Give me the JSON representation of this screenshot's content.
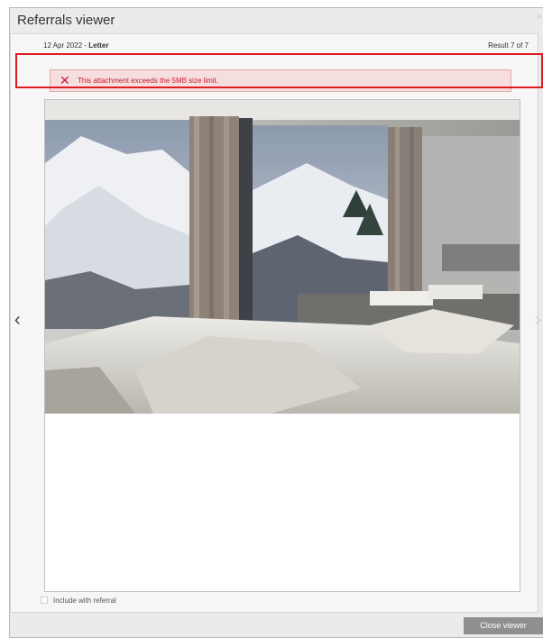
{
  "window": {
    "title": "Referrals viewer",
    "close_glyph": "×"
  },
  "header": {
    "date": "12 Apr 2022",
    "separator": " - ",
    "doc_type": "Letter",
    "result": "Result 7 of 7"
  },
  "error": {
    "icon": "x-icon",
    "icon_glyph": "✕",
    "message": "This attachment exceeds the 5MB size limit."
  },
  "nav": {
    "prev_glyph": "‹",
    "next_glyph": "›"
  },
  "include": {
    "label": "Include with referral",
    "checked": false
  },
  "footer": {
    "close_label": "Close viewer"
  },
  "colors": {
    "error_text": "#c8172e",
    "error_bg": "#f6dede",
    "highlight": "#e01b24",
    "button_bg": "#8f8f8f"
  }
}
